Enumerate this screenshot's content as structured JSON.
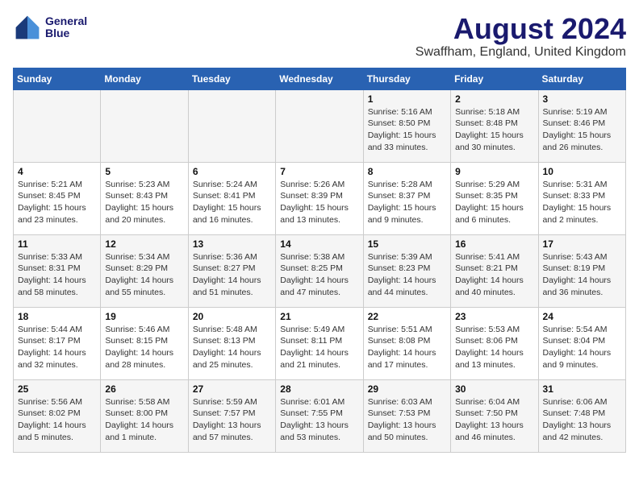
{
  "header": {
    "logo_line1": "General",
    "logo_line2": "Blue",
    "title": "August 2024",
    "subtitle": "Swaffham, England, United Kingdom"
  },
  "weekdays": [
    "Sunday",
    "Monday",
    "Tuesday",
    "Wednesday",
    "Thursday",
    "Friday",
    "Saturday"
  ],
  "weeks": [
    {
      "days": [
        {
          "num": "",
          "info": ""
        },
        {
          "num": "",
          "info": ""
        },
        {
          "num": "",
          "info": ""
        },
        {
          "num": "",
          "info": ""
        },
        {
          "num": "1",
          "info": "Sunrise: 5:16 AM\nSunset: 8:50 PM\nDaylight: 15 hours\nand 33 minutes."
        },
        {
          "num": "2",
          "info": "Sunrise: 5:18 AM\nSunset: 8:48 PM\nDaylight: 15 hours\nand 30 minutes."
        },
        {
          "num": "3",
          "info": "Sunrise: 5:19 AM\nSunset: 8:46 PM\nDaylight: 15 hours\nand 26 minutes."
        }
      ]
    },
    {
      "days": [
        {
          "num": "4",
          "info": "Sunrise: 5:21 AM\nSunset: 8:45 PM\nDaylight: 15 hours\nand 23 minutes."
        },
        {
          "num": "5",
          "info": "Sunrise: 5:23 AM\nSunset: 8:43 PM\nDaylight: 15 hours\nand 20 minutes."
        },
        {
          "num": "6",
          "info": "Sunrise: 5:24 AM\nSunset: 8:41 PM\nDaylight: 15 hours\nand 16 minutes."
        },
        {
          "num": "7",
          "info": "Sunrise: 5:26 AM\nSunset: 8:39 PM\nDaylight: 15 hours\nand 13 minutes."
        },
        {
          "num": "8",
          "info": "Sunrise: 5:28 AM\nSunset: 8:37 PM\nDaylight: 15 hours\nand 9 minutes."
        },
        {
          "num": "9",
          "info": "Sunrise: 5:29 AM\nSunset: 8:35 PM\nDaylight: 15 hours\nand 6 minutes."
        },
        {
          "num": "10",
          "info": "Sunrise: 5:31 AM\nSunset: 8:33 PM\nDaylight: 15 hours\nand 2 minutes."
        }
      ]
    },
    {
      "days": [
        {
          "num": "11",
          "info": "Sunrise: 5:33 AM\nSunset: 8:31 PM\nDaylight: 14 hours\nand 58 minutes."
        },
        {
          "num": "12",
          "info": "Sunrise: 5:34 AM\nSunset: 8:29 PM\nDaylight: 14 hours\nand 55 minutes."
        },
        {
          "num": "13",
          "info": "Sunrise: 5:36 AM\nSunset: 8:27 PM\nDaylight: 14 hours\nand 51 minutes."
        },
        {
          "num": "14",
          "info": "Sunrise: 5:38 AM\nSunset: 8:25 PM\nDaylight: 14 hours\nand 47 minutes."
        },
        {
          "num": "15",
          "info": "Sunrise: 5:39 AM\nSunset: 8:23 PM\nDaylight: 14 hours\nand 44 minutes."
        },
        {
          "num": "16",
          "info": "Sunrise: 5:41 AM\nSunset: 8:21 PM\nDaylight: 14 hours\nand 40 minutes."
        },
        {
          "num": "17",
          "info": "Sunrise: 5:43 AM\nSunset: 8:19 PM\nDaylight: 14 hours\nand 36 minutes."
        }
      ]
    },
    {
      "days": [
        {
          "num": "18",
          "info": "Sunrise: 5:44 AM\nSunset: 8:17 PM\nDaylight: 14 hours\nand 32 minutes."
        },
        {
          "num": "19",
          "info": "Sunrise: 5:46 AM\nSunset: 8:15 PM\nDaylight: 14 hours\nand 28 minutes."
        },
        {
          "num": "20",
          "info": "Sunrise: 5:48 AM\nSunset: 8:13 PM\nDaylight: 14 hours\nand 25 minutes."
        },
        {
          "num": "21",
          "info": "Sunrise: 5:49 AM\nSunset: 8:11 PM\nDaylight: 14 hours\nand 21 minutes."
        },
        {
          "num": "22",
          "info": "Sunrise: 5:51 AM\nSunset: 8:08 PM\nDaylight: 14 hours\nand 17 minutes."
        },
        {
          "num": "23",
          "info": "Sunrise: 5:53 AM\nSunset: 8:06 PM\nDaylight: 14 hours\nand 13 minutes."
        },
        {
          "num": "24",
          "info": "Sunrise: 5:54 AM\nSunset: 8:04 PM\nDaylight: 14 hours\nand 9 minutes."
        }
      ]
    },
    {
      "days": [
        {
          "num": "25",
          "info": "Sunrise: 5:56 AM\nSunset: 8:02 PM\nDaylight: 14 hours\nand 5 minutes."
        },
        {
          "num": "26",
          "info": "Sunrise: 5:58 AM\nSunset: 8:00 PM\nDaylight: 14 hours\nand 1 minute."
        },
        {
          "num": "27",
          "info": "Sunrise: 5:59 AM\nSunset: 7:57 PM\nDaylight: 13 hours\nand 57 minutes."
        },
        {
          "num": "28",
          "info": "Sunrise: 6:01 AM\nSunset: 7:55 PM\nDaylight: 13 hours\nand 53 minutes."
        },
        {
          "num": "29",
          "info": "Sunrise: 6:03 AM\nSunset: 7:53 PM\nDaylight: 13 hours\nand 50 minutes."
        },
        {
          "num": "30",
          "info": "Sunrise: 6:04 AM\nSunset: 7:50 PM\nDaylight: 13 hours\nand 46 minutes."
        },
        {
          "num": "31",
          "info": "Sunrise: 6:06 AM\nSunset: 7:48 PM\nDaylight: 13 hours\nand 42 minutes."
        }
      ]
    }
  ]
}
